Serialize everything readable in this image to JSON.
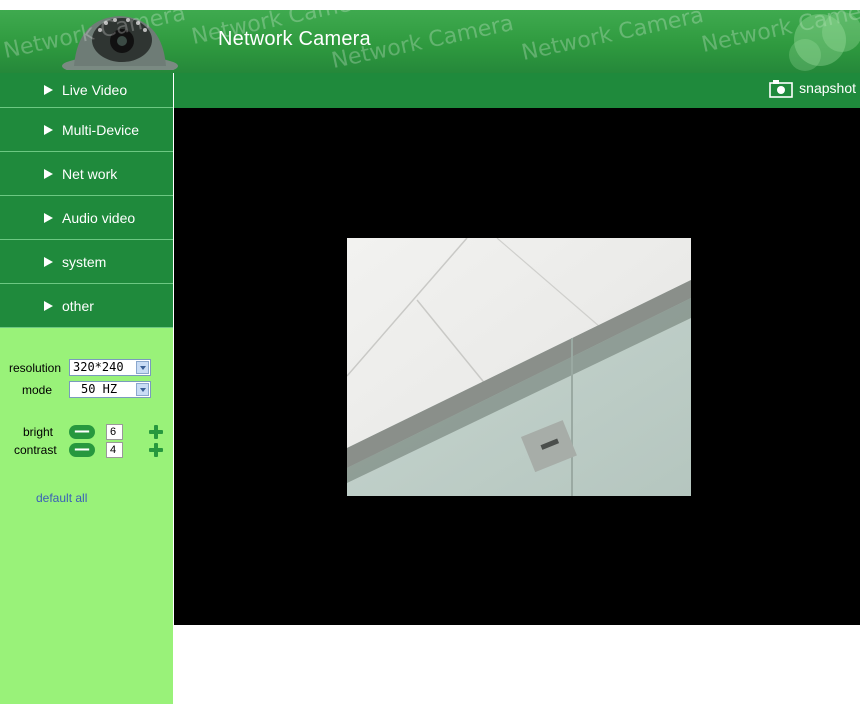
{
  "header": {
    "title": "Network Camera",
    "watermark": "Network Camera"
  },
  "sidebar": {
    "items": [
      {
        "label": "Live Video"
      },
      {
        "label": "Multi-Device"
      },
      {
        "label": "Net work"
      },
      {
        "label": "Audio video"
      },
      {
        "label": "system"
      },
      {
        "label": "other"
      }
    ]
  },
  "controls": {
    "resolution_label": "resolution",
    "resolution_value": "320*240",
    "mode_label": "mode",
    "mode_value": "50 HZ",
    "bright_label": "bright",
    "bright_value": "6",
    "contrast_label": "contrast",
    "contrast_value": "4",
    "minus_symbol": "—",
    "default_all": "default all"
  },
  "toolbar": {
    "snapshot_label": "snapshot"
  },
  "colors": {
    "nav_green": "#1f8a3c",
    "panel_green": "#99f279",
    "accent_green": "#27983e",
    "link_blue": "#3a5fb8"
  },
  "icons": [
    "camera-logo-icon",
    "play-arrow-icon",
    "dropdown-arrow-icon",
    "minus-icon",
    "plus-icon",
    "snapshot-camera-icon"
  ]
}
